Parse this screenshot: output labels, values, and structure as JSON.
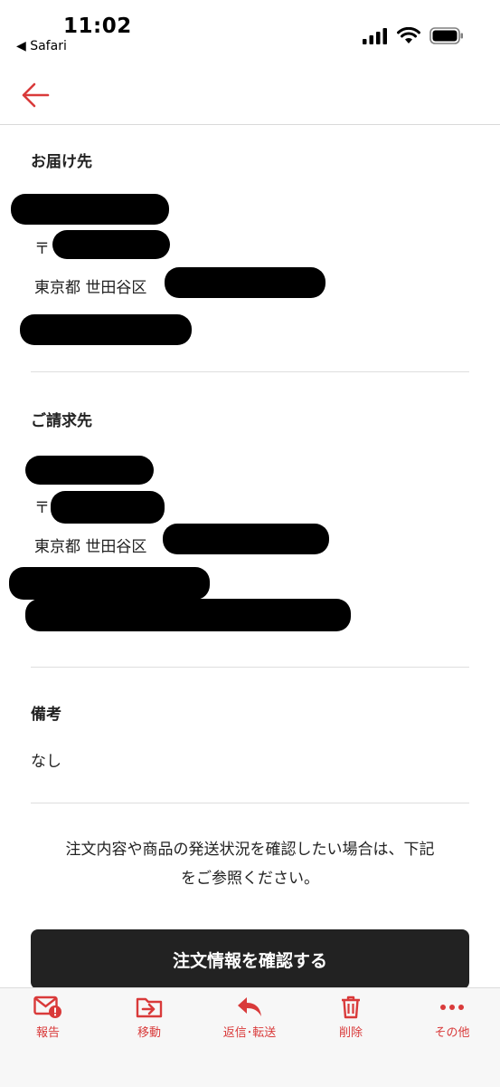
{
  "status_bar": {
    "time": "11:02",
    "back_app": "◀ Safari"
  },
  "shipping": {
    "title": "お届け先",
    "postal_prefix": "〒",
    "address_prefix": "東京都 世田谷区"
  },
  "billing": {
    "title": "ご請求先",
    "postal_prefix": "〒",
    "address_prefix": "東京都 世田谷区"
  },
  "remarks": {
    "title": "備考",
    "value": "なし"
  },
  "notice": {
    "line1": "注文内容や商品の発送状況を確認したい場合は、下記",
    "line2": "をご参照ください。"
  },
  "confirm_button": "注文情報を確認する",
  "toolbar": {
    "report": "報告",
    "move": "移動",
    "reply_forward": "返信･転送",
    "delete": "削除",
    "more": "その他"
  },
  "colors": {
    "accent": "#d93a3a",
    "button": "#222222"
  }
}
